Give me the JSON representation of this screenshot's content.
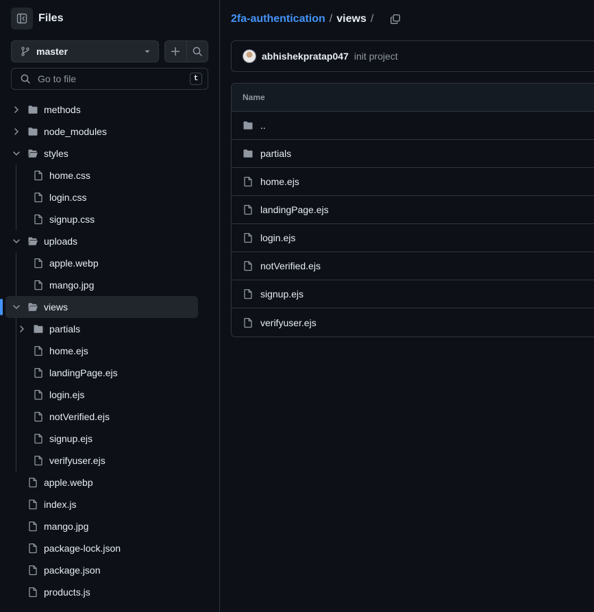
{
  "sidebar": {
    "title": "Files",
    "branch": "master",
    "goto_placeholder": "Go to file",
    "goto_shortcut": "t",
    "tree": [
      {
        "name": "methods",
        "type": "folder",
        "depth": 0,
        "expanded": false,
        "active": false
      },
      {
        "name": "node_modules",
        "type": "folder",
        "depth": 0,
        "expanded": false,
        "active": false
      },
      {
        "name": "styles",
        "type": "folder",
        "depth": 0,
        "expanded": true,
        "active": false
      },
      {
        "name": "home.css",
        "type": "file",
        "depth": 1,
        "active": false
      },
      {
        "name": "login.css",
        "type": "file",
        "depth": 1,
        "active": false
      },
      {
        "name": "signup.css",
        "type": "file",
        "depth": 1,
        "active": false
      },
      {
        "name": "uploads",
        "type": "folder",
        "depth": 0,
        "expanded": true,
        "active": false
      },
      {
        "name": "apple.webp",
        "type": "file",
        "depth": 1,
        "active": false
      },
      {
        "name": "mango.jpg",
        "type": "file",
        "depth": 1,
        "active": false
      },
      {
        "name": "views",
        "type": "folder",
        "depth": 0,
        "expanded": true,
        "active": true
      },
      {
        "name": "partials",
        "type": "folder",
        "depth": 1,
        "expanded": false,
        "active": false
      },
      {
        "name": "home.ejs",
        "type": "file",
        "depth": 1,
        "active": false
      },
      {
        "name": "landingPage.ejs",
        "type": "file",
        "depth": 1,
        "active": false
      },
      {
        "name": "login.ejs",
        "type": "file",
        "depth": 1,
        "active": false
      },
      {
        "name": "notVerified.ejs",
        "type": "file",
        "depth": 1,
        "active": false
      },
      {
        "name": "signup.ejs",
        "type": "file",
        "depth": 1,
        "active": false
      },
      {
        "name": "verifyuser.ejs",
        "type": "file",
        "depth": 1,
        "active": false
      },
      {
        "name": "apple.webp",
        "type": "file",
        "depth": 0,
        "active": false
      },
      {
        "name": "index.js",
        "type": "file",
        "depth": 0,
        "active": false
      },
      {
        "name": "mango.jpg",
        "type": "file",
        "depth": 0,
        "active": false
      },
      {
        "name": "package-lock.json",
        "type": "file",
        "depth": 0,
        "active": false
      },
      {
        "name": "package.json",
        "type": "file",
        "depth": 0,
        "active": false
      },
      {
        "name": "products.js",
        "type": "file",
        "depth": 0,
        "active": false
      }
    ]
  },
  "breadcrumb": {
    "repo": "2fa-authentication",
    "separator": "/",
    "current": "views",
    "trailing": "/"
  },
  "commit": {
    "author": "abhishekpratap047",
    "message": "init project"
  },
  "file_table": {
    "header": "Name",
    "rows": [
      {
        "name": "..",
        "type": "folder"
      },
      {
        "name": "partials",
        "type": "folder"
      },
      {
        "name": "home.ejs",
        "type": "file"
      },
      {
        "name": "landingPage.ejs",
        "type": "file"
      },
      {
        "name": "login.ejs",
        "type": "file"
      },
      {
        "name": "notVerified.ejs",
        "type": "file"
      },
      {
        "name": "signup.ejs",
        "type": "file"
      },
      {
        "name": "verifyuser.ejs",
        "type": "file"
      }
    ]
  },
  "icons": {
    "sidebar_toggle": "sidebar-collapse-icon",
    "branch": "git-branch-icon",
    "dropdown": "triangle-down-icon",
    "add": "plus-icon",
    "search": "search-icon",
    "folder": "folder-icon",
    "folder_open": "folder-open-icon",
    "file": "file-icon",
    "copy": "copy-icon",
    "chevron_right": "chevron-right-icon",
    "chevron_down": "chevron-down-icon"
  },
  "colors": {
    "background": "#0d1117",
    "border": "#30363d",
    "accent": "#4493f8",
    "text": "#e6edf3",
    "muted": "#9198a1",
    "folder_icon": "#9198a1"
  }
}
